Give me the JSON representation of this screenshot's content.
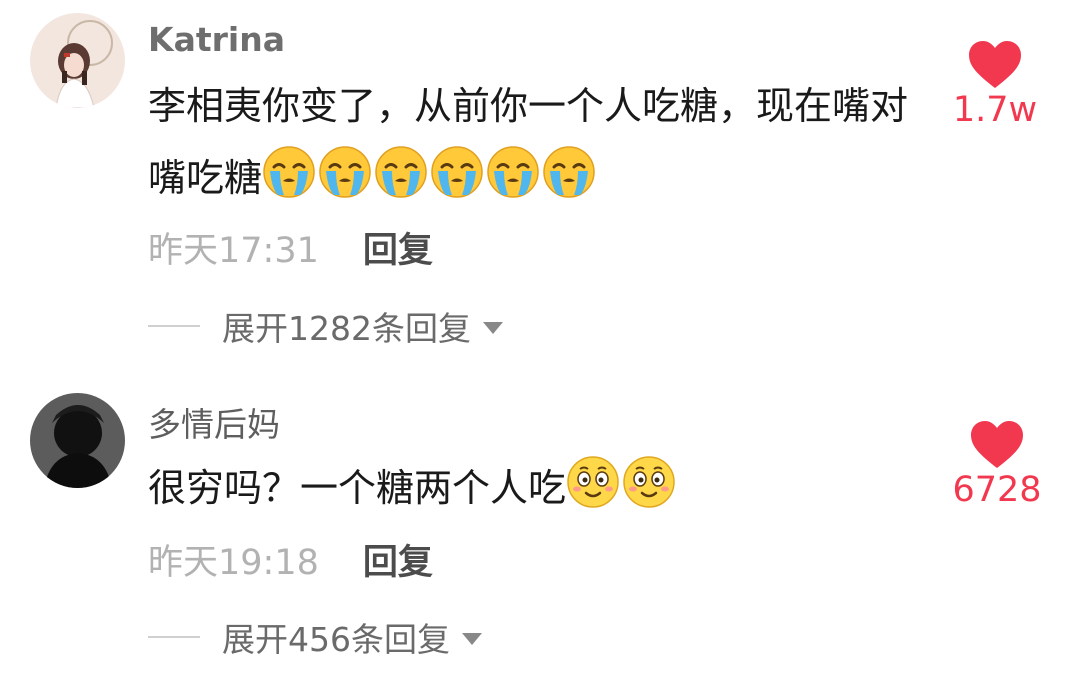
{
  "comments": [
    {
      "username": "Katrina",
      "text": "李相夷你变了，从前你一个人吃糖，现在嘴对嘴吃糖",
      "emoji": "crying-face-emoji",
      "emoji_count": 6,
      "time": "昨天17:31",
      "reply_label": "回复",
      "expand_label": "展开1282条回复",
      "likes": "1.7w"
    },
    {
      "username": "多情后妈",
      "text": "很穷吗？一个糖两个人吃",
      "emoji": "smiling-face-emoji",
      "emoji_count": 2,
      "time": "昨天19:18",
      "reply_label": "回复",
      "expand_label": "展开456条回复",
      "likes": "6728"
    }
  ],
  "colors": {
    "like_red": "#f2384e",
    "timestamp_gray": "#b2b2b2",
    "text_dark": "#1a1a1a"
  },
  "icons": {
    "like": "heart-icon",
    "expand": "triangle-down-icon"
  }
}
